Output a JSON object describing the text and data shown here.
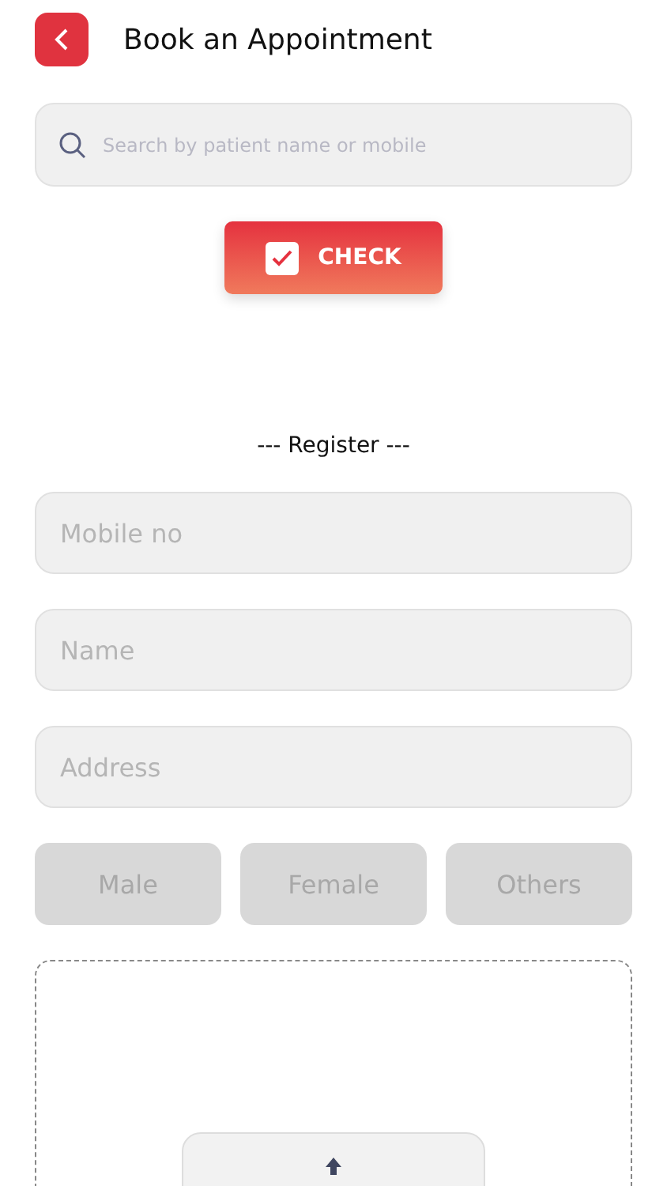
{
  "header": {
    "title": "Book an Appointment"
  },
  "search": {
    "placeholder": "Search by patient name or mobile"
  },
  "check_button": {
    "label": "CHECK",
    "checked": true
  },
  "section_title": "--- Register ---",
  "fields": [
    {
      "placeholder": "Mobile no"
    },
    {
      "placeholder": "Name"
    },
    {
      "placeholder": "Address"
    }
  ],
  "genders": [
    {
      "label": "Male",
      "selected": false
    },
    {
      "label": "Female",
      "selected": false
    },
    {
      "label": "Others",
      "selected": false
    }
  ],
  "upload": {
    "kind": "dropzone"
  }
}
